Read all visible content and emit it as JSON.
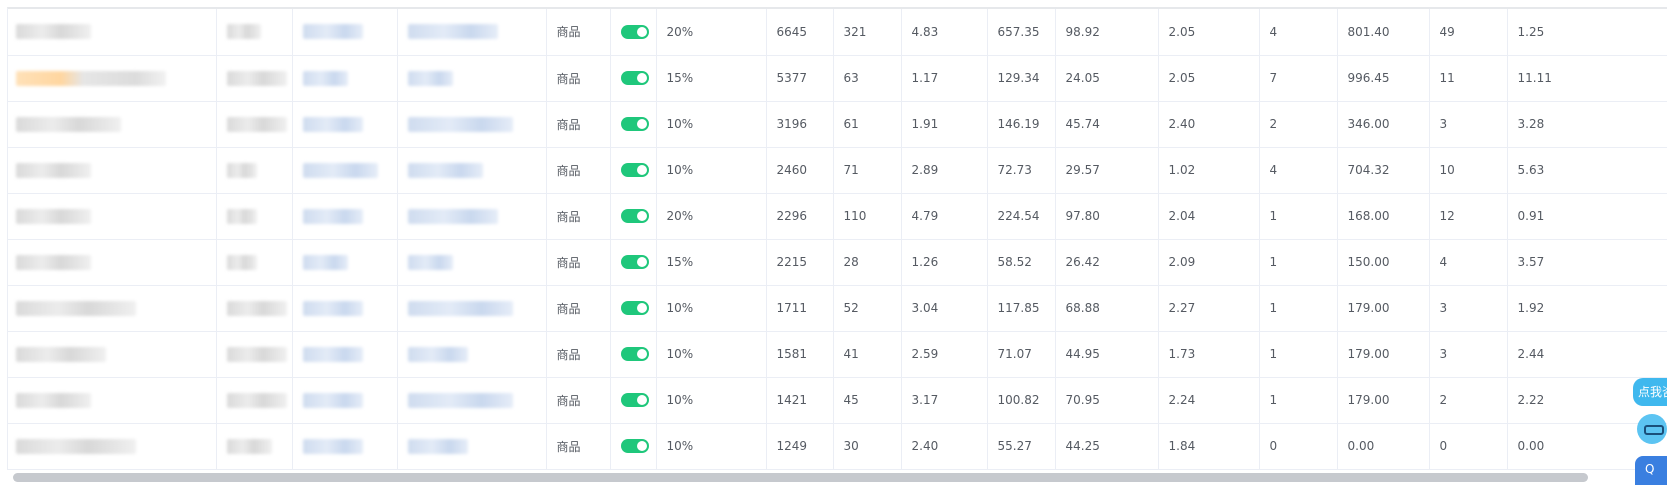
{
  "colors": {
    "toggle_on": "#1fc77b",
    "border": "#ebeef5",
    "text": "#555a62",
    "scroll_thumb": "#c6c9ce",
    "help_widget": "#3fb8ee"
  },
  "table": {
    "rows": [
      {
        "type": "商品",
        "enabled": true,
        "rate": "20%",
        "c1": "6645",
        "c2": "321",
        "c3": "4.83",
        "c4": "657.35",
        "c5": "98.92",
        "c6": "2.05",
        "c7": "4",
        "c8": "801.40",
        "c9": "49",
        "c10": "1.25"
      },
      {
        "type": "商品",
        "enabled": true,
        "rate": "15%",
        "c1": "5377",
        "c2": "63",
        "c3": "1.17",
        "c4": "129.34",
        "c5": "24.05",
        "c6": "2.05",
        "c7": "7",
        "c8": "996.45",
        "c9": "11",
        "c10": "11.11"
      },
      {
        "type": "商品",
        "enabled": true,
        "rate": "10%",
        "c1": "3196",
        "c2": "61",
        "c3": "1.91",
        "c4": "146.19",
        "c5": "45.74",
        "c6": "2.40",
        "c7": "2",
        "c8": "346.00",
        "c9": "3",
        "c10": "3.28"
      },
      {
        "type": "商品",
        "enabled": true,
        "rate": "10%",
        "c1": "2460",
        "c2": "71",
        "c3": "2.89",
        "c4": "72.73",
        "c5": "29.57",
        "c6": "1.02",
        "c7": "4",
        "c8": "704.32",
        "c9": "10",
        "c10": "5.63"
      },
      {
        "type": "商品",
        "enabled": true,
        "rate": "20%",
        "c1": "2296",
        "c2": "110",
        "c3": "4.79",
        "c4": "224.54",
        "c5": "97.80",
        "c6": "2.04",
        "c7": "1",
        "c8": "168.00",
        "c9": "12",
        "c10": "0.91"
      },
      {
        "type": "商品",
        "enabled": true,
        "rate": "15%",
        "c1": "2215",
        "c2": "28",
        "c3": "1.26",
        "c4": "58.52",
        "c5": "26.42",
        "c6": "2.09",
        "c7": "1",
        "c8": "150.00",
        "c9": "4",
        "c10": "3.57"
      },
      {
        "type": "商品",
        "enabled": true,
        "rate": "10%",
        "c1": "1711",
        "c2": "52",
        "c3": "3.04",
        "c4": "117.85",
        "c5": "68.88",
        "c6": "2.27",
        "c7": "1",
        "c8": "179.00",
        "c9": "3",
        "c10": "1.92"
      },
      {
        "type": "商品",
        "enabled": true,
        "rate": "10%",
        "c1": "1581",
        "c2": "41",
        "c3": "2.59",
        "c4": "71.07",
        "c5": "44.95",
        "c6": "1.73",
        "c7": "1",
        "c8": "179.00",
        "c9": "3",
        "c10": "2.44"
      },
      {
        "type": "商品",
        "enabled": true,
        "rate": "10%",
        "c1": "1421",
        "c2": "45",
        "c3": "3.17",
        "c4": "100.82",
        "c5": "70.95",
        "c6": "2.24",
        "c7": "1",
        "c8": "179.00",
        "c9": "2",
        "c10": "2.22"
      },
      {
        "type": "商品",
        "enabled": true,
        "rate": "10%",
        "c1": "1249",
        "c2": "30",
        "c3": "2.40",
        "c4": "55.27",
        "c5": "44.25",
        "c6": "1.84",
        "c7": "0",
        "c8": "0.00",
        "c9": "0",
        "c10": "0.00"
      }
    ]
  },
  "help_widget": {
    "label": "点我咨询"
  }
}
